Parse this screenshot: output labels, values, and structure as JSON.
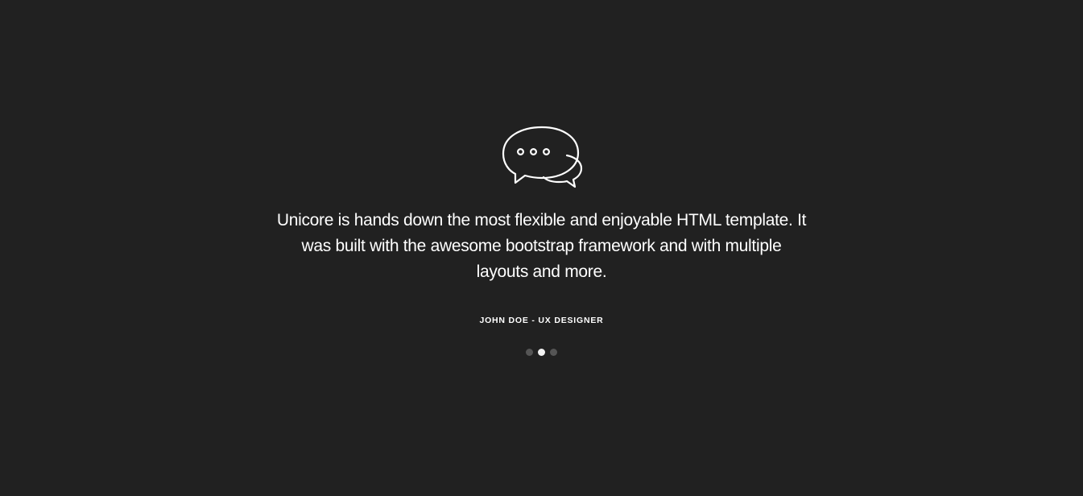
{
  "testimonial": {
    "icon": "speech-bubbles-icon",
    "quote": "Unicore is hands down the most flexible and enjoyable HTML template. It was built with the awesome bootstrap framework and with multiple layouts and more.",
    "author": "JOHN DOE - UX DESIGNER"
  },
  "carousel": {
    "slide_count": 3,
    "active_index": 1
  },
  "colors": {
    "background": "#212121",
    "text": "#ffffff",
    "dot_inactive": "#555555",
    "dot_active": "#f2f2f2"
  }
}
